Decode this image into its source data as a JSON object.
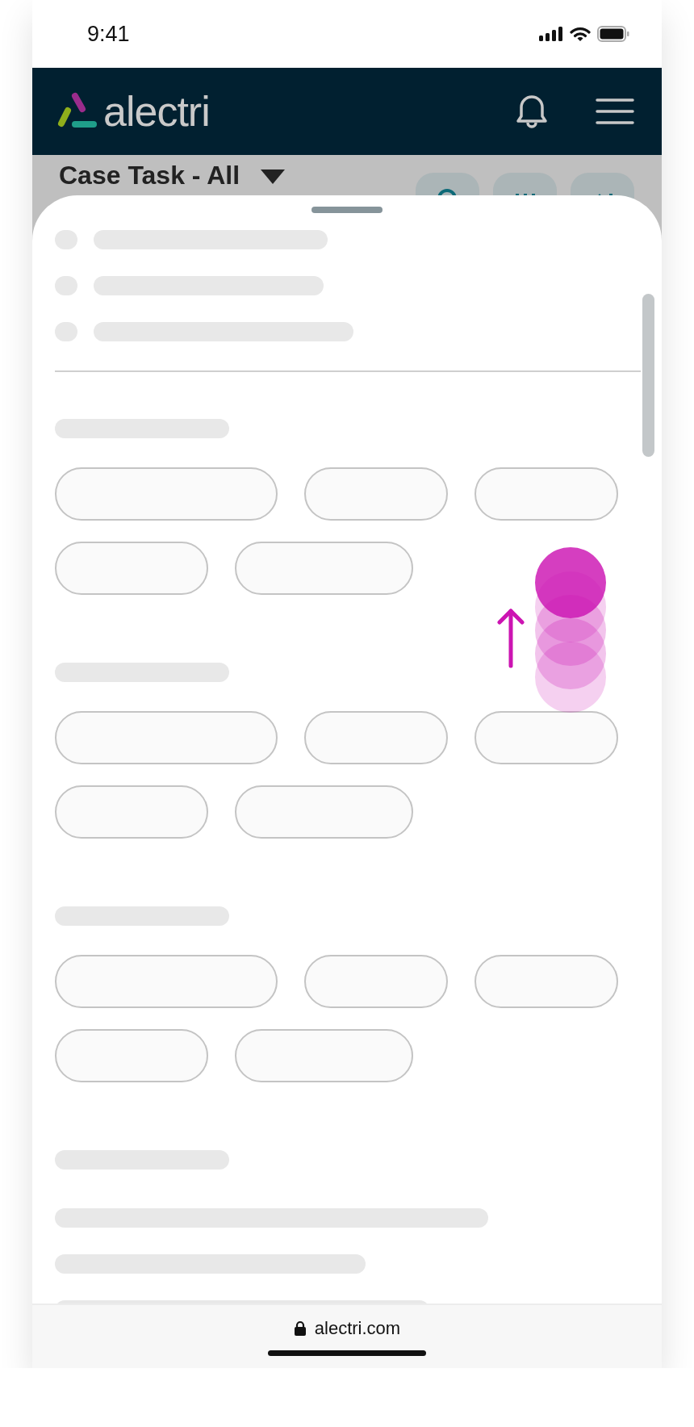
{
  "status_bar": {
    "time": "9:41"
  },
  "header": {
    "logo": "alectri"
  },
  "page": {
    "title": "Case Task - All"
  },
  "browser_bar": {
    "url": "alectri.com"
  }
}
